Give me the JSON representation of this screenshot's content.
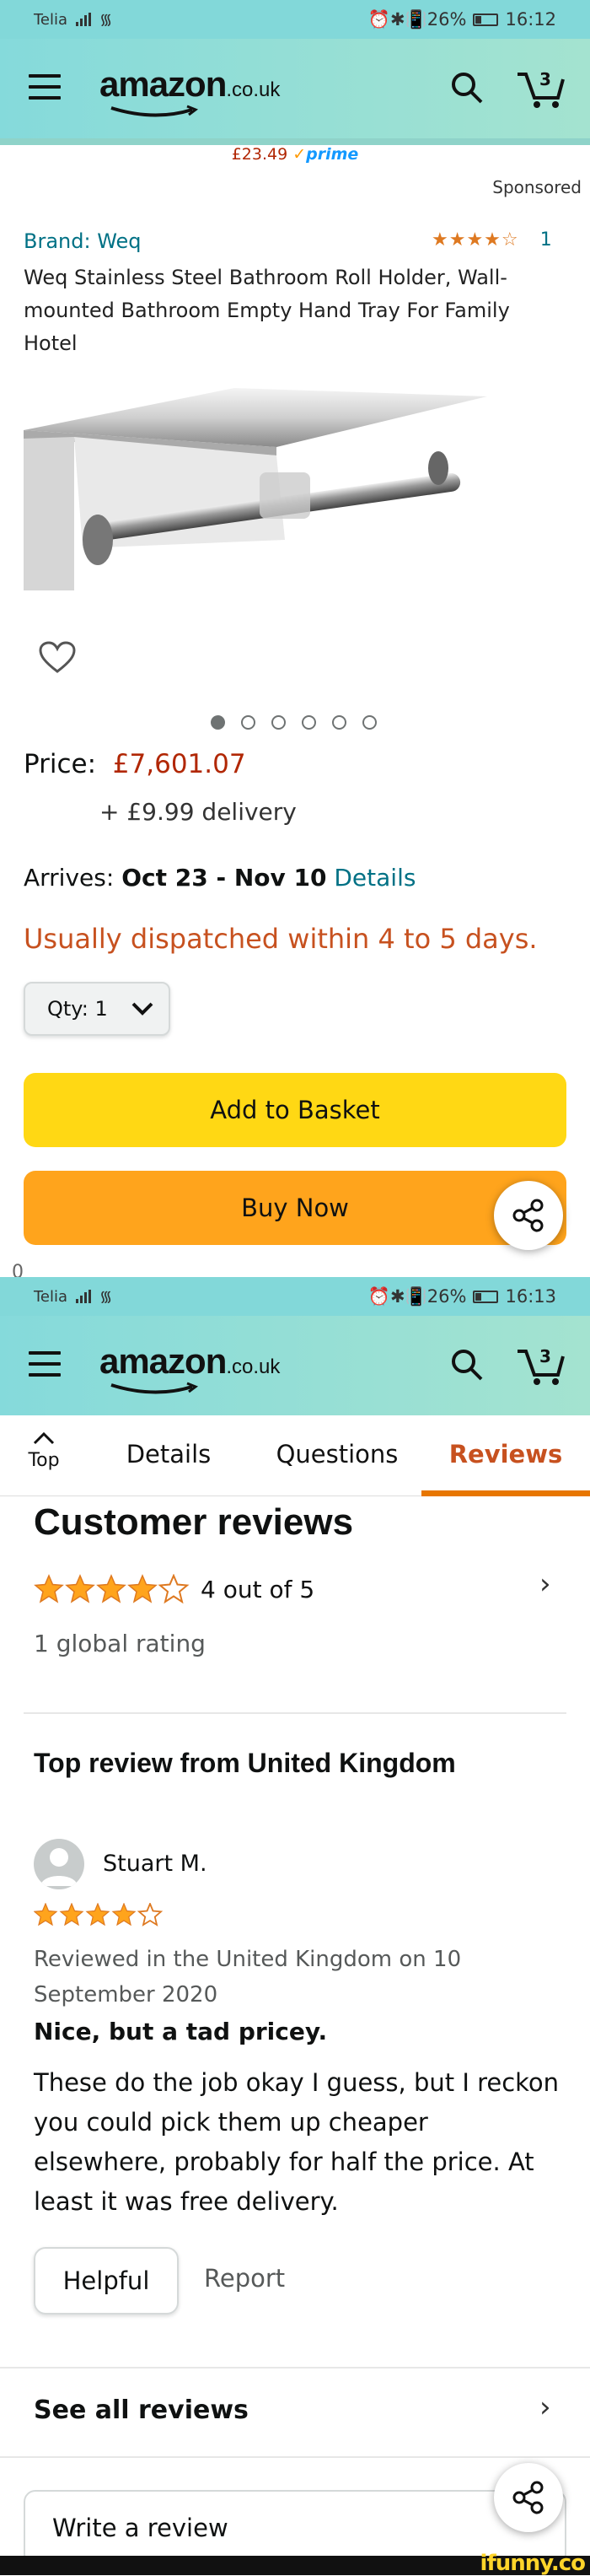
{
  "screen1": {
    "status": {
      "carrier": "Telia",
      "icons": "⏰✱📳26%",
      "time": "16:12"
    },
    "header": {
      "logo": "amazon",
      "logo_domain": ".co.uk",
      "cart_count": "3"
    },
    "price_strip": {
      "price": "£23.49",
      "prime": "prime"
    },
    "sponsored": "Sponsored",
    "product": {
      "brand": "Brand: Weq",
      "stars": "★★★★☆",
      "rating_count": "1",
      "title": "Weq Stainless Steel Bathroom Roll Holder, Wall-mounted Bathroom Empty Hand Tray For Family Hotel",
      "image_count": 6,
      "price_label": "Price:",
      "price": "£7,601.07",
      "delivery": "+ £9.99 delivery",
      "arrives_label": "Arrives:",
      "arrives_dates": "Oct 23 - Nov 10",
      "arrives_link": "Details",
      "dispatch": "Usually dispatched within 4 to 5 days.",
      "qty_label": "Qty:",
      "qty_value": "1",
      "add_to_basket": "Add to Basket",
      "buy_now": "Buy Now",
      "cutoff_text": "0"
    }
  },
  "screen2": {
    "status": {
      "carrier": "Telia",
      "icons": "⏰✱📳26%",
      "time": "16:13"
    },
    "header": {
      "logo": "amazon",
      "logo_domain": ".co.uk",
      "cart_count": "3"
    },
    "tabs": {
      "top": "Top",
      "details": "Details",
      "questions": "Questions",
      "reviews": "Reviews"
    },
    "reviews": {
      "heading": "Customer reviews",
      "rating_text": "4 out of 5",
      "global": "1 global rating",
      "top_review_heading": "Top review from United Kingdom",
      "reviewer": "Stuart M.",
      "date": "Reviewed in the United Kingdom on 10 September 2020",
      "title": "Nice, but a tad pricey.",
      "body": "These do the job okay I guess, but I reckon you could pick them up cheaper elsewhere, probably for half the price. At least it was free delivery.",
      "helpful": "Helpful",
      "report": "Report",
      "see_all": "See all reviews",
      "write": "Write a review"
    }
  },
  "footer": {
    "watermark": "ifunny.co"
  },
  "colors": {
    "header": "#85dadb",
    "accent": "#e77600",
    "price": "#b12704",
    "link": "#007185",
    "add": "#ffd814",
    "buy": "#ffa41c"
  }
}
